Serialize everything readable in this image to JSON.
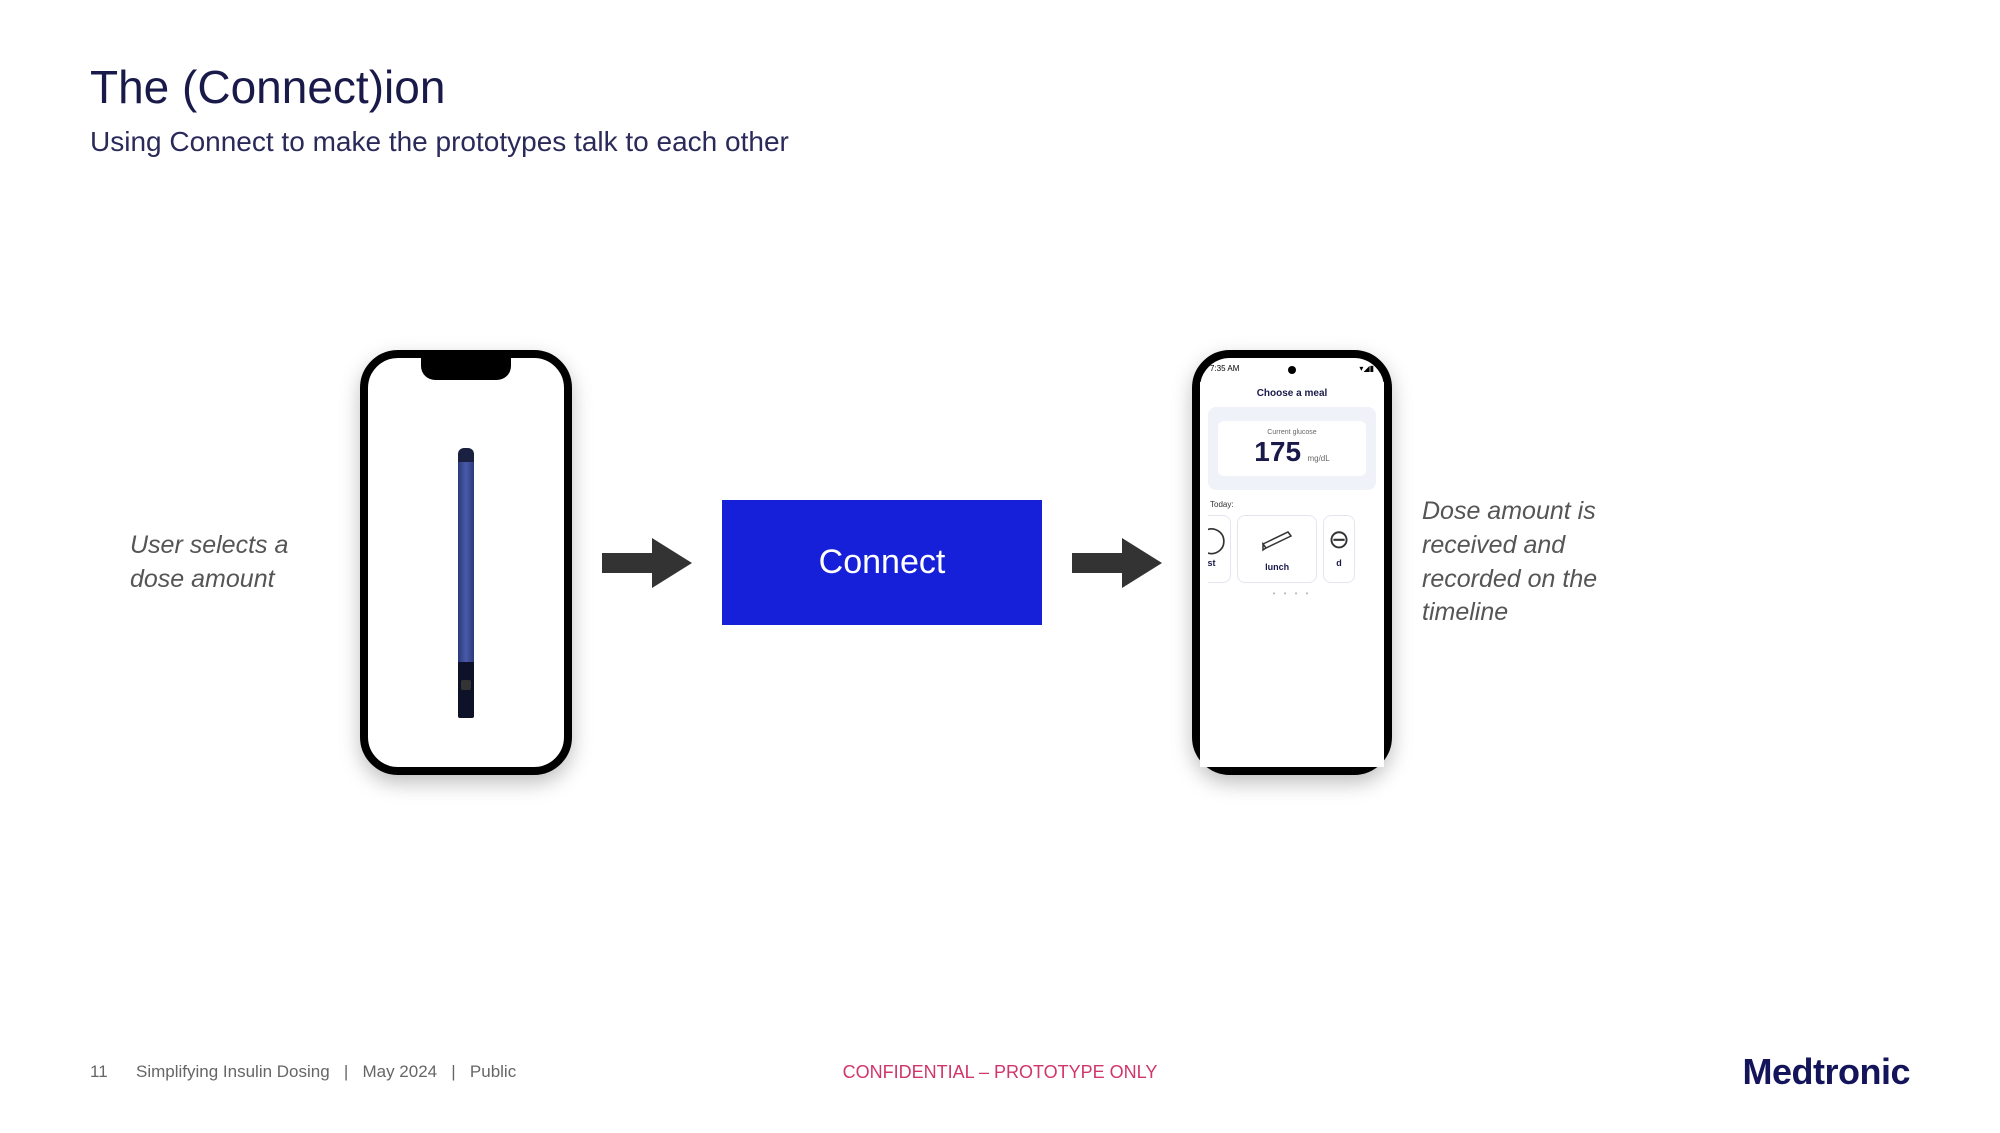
{
  "header": {
    "title": "The (Connect)ion",
    "subtitle": "Using Connect to make the prototypes talk to each other"
  },
  "flow": {
    "left_caption": "User selects a dose amount",
    "right_caption": "Dose amount is received and recorded on the timeline",
    "connect_label": "Connect"
  },
  "app": {
    "status_time": "7:35 AM",
    "screen_title": "Choose a meal",
    "glucose_label": "Current glucose",
    "glucose_value": "175",
    "glucose_unit": "mg/dL",
    "today_label": "Today:",
    "meal_left": "st",
    "meal_center": "lunch",
    "meal_right": "d"
  },
  "footer": {
    "page_number": "11",
    "doc_title": "Simplifying Insulin Dosing",
    "date": "May 2024",
    "visibility": "Public",
    "confidential": "CONFIDENTIAL – PROTOTYPE ONLY",
    "brand": "Medtronic"
  }
}
